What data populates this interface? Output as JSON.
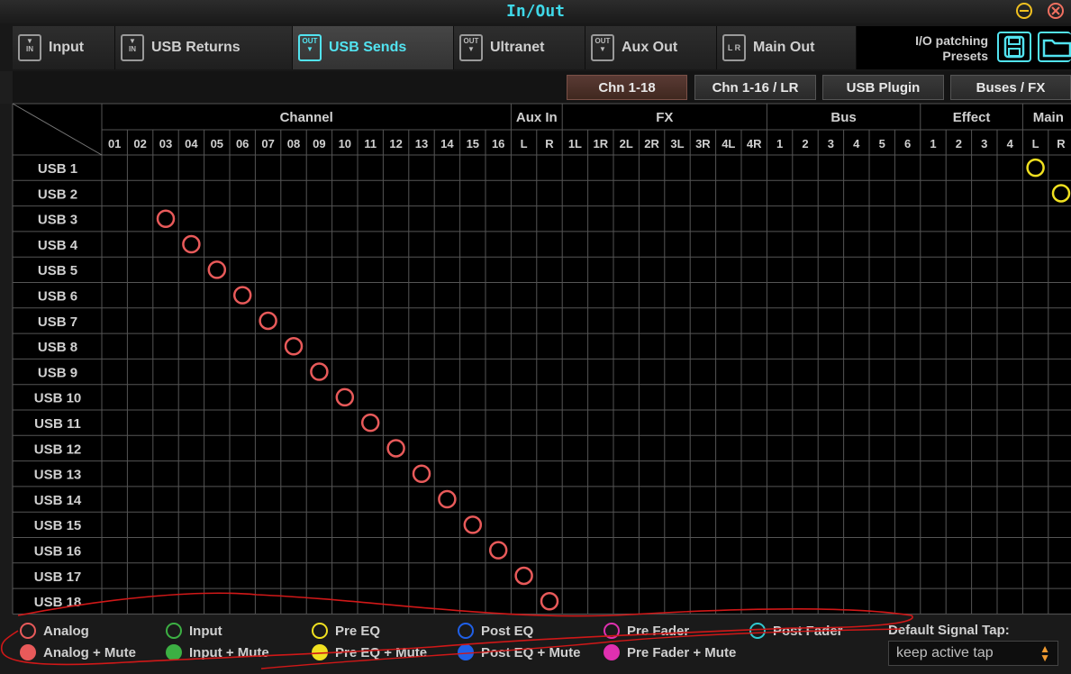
{
  "window": {
    "title": "In/Out"
  },
  "tabs": [
    {
      "label": "Input",
      "icon": "in-port-icon",
      "icon_text": "IN"
    },
    {
      "label": "USB Returns",
      "icon": "in-port-icon",
      "icon_text": "IN"
    },
    {
      "label": "USB Sends",
      "icon": "out-port-icon",
      "icon_text": "OUT",
      "active": true
    },
    {
      "label": "Ultranet",
      "icon": "out-port-icon",
      "icon_text": "OUT"
    },
    {
      "label": "Aux Out",
      "icon": "out-port-icon",
      "icon_text": "OUT"
    },
    {
      "label": "Main Out",
      "icon": "lr-fader-icon",
      "icon_text": "L R"
    }
  ],
  "presets": {
    "line1": "I/O patching",
    "line2": "Presets"
  },
  "subtabs": [
    "Chn 1-18",
    "Chn 1-16 / LR",
    "USB Plugin",
    "Buses / FX"
  ],
  "active_subtab": 0,
  "groups": [
    {
      "label": "Channel",
      "span": 16
    },
    {
      "label": "Aux In",
      "span": 2
    },
    {
      "label": "FX",
      "span": 8
    },
    {
      "label": "Bus",
      "span": 6
    },
    {
      "label": "Effect",
      "span": 4
    },
    {
      "label": "Main",
      "span": 2
    }
  ],
  "columns": [
    "01",
    "02",
    "03",
    "04",
    "05",
    "06",
    "07",
    "08",
    "09",
    "10",
    "11",
    "12",
    "13",
    "14",
    "15",
    "16",
    "L",
    "R",
    "1L",
    "1R",
    "2L",
    "2R",
    "3L",
    "3R",
    "4L",
    "4R",
    "1",
    "2",
    "3",
    "4",
    "5",
    "6",
    "1",
    "2",
    "3",
    "4",
    "L",
    "R"
  ],
  "rows": [
    "USB 1",
    "USB 2",
    "USB 3",
    "USB 4",
    "USB 5",
    "USB 6",
    "USB 7",
    "USB 8",
    "USB 9",
    "USB 10",
    "USB 11",
    "USB 12",
    "USB 13",
    "USB 14",
    "USB 15",
    "USB 16",
    "USB 17",
    "USB 18"
  ],
  "patches": [
    {
      "row": 0,
      "col": 36,
      "type": "pre-eq"
    },
    {
      "row": 1,
      "col": 37,
      "type": "pre-eq"
    },
    {
      "row": 2,
      "col": 2,
      "type": "analog"
    },
    {
      "row": 3,
      "col": 3,
      "type": "analog"
    },
    {
      "row": 4,
      "col": 4,
      "type": "analog"
    },
    {
      "row": 5,
      "col": 5,
      "type": "analog"
    },
    {
      "row": 6,
      "col": 6,
      "type": "analog"
    },
    {
      "row": 7,
      "col": 7,
      "type": "analog"
    },
    {
      "row": 8,
      "col": 8,
      "type": "analog"
    },
    {
      "row": 9,
      "col": 9,
      "type": "analog"
    },
    {
      "row": 10,
      "col": 10,
      "type": "analog"
    },
    {
      "row": 11,
      "col": 11,
      "type": "analog"
    },
    {
      "row": 12,
      "col": 12,
      "type": "analog"
    },
    {
      "row": 13,
      "col": 13,
      "type": "analog"
    },
    {
      "row": 14,
      "col": 14,
      "type": "analog"
    },
    {
      "row": 15,
      "col": 15,
      "type": "analog"
    },
    {
      "row": 16,
      "col": 16,
      "type": "analog"
    },
    {
      "row": 17,
      "col": 17,
      "type": "analog"
    }
  ],
  "legend": [
    {
      "label": "Analog",
      "color": "#e85a5a",
      "filled": false
    },
    {
      "label": "Input",
      "color": "#3cb043",
      "filled": false
    },
    {
      "label": "Pre EQ",
      "color": "#f0e020",
      "filled": false
    },
    {
      "label": "Post EQ",
      "color": "#2060e8",
      "filled": false
    },
    {
      "label": "Pre Fader",
      "color": "#e030b0",
      "filled": false
    },
    {
      "label": "Post Fader",
      "color": "#30c8d0",
      "filled": false
    },
    {
      "label": "Analog + Mute",
      "color": "#e85a5a",
      "filled": true
    },
    {
      "label": "Input + Mute",
      "color": "#3cb043",
      "filled": true
    },
    {
      "label": "Pre EQ + Mute",
      "color": "#f0e020",
      "filled": true
    },
    {
      "label": "Post EQ + Mute",
      "color": "#2060e8",
      "filled": true
    },
    {
      "label": "Pre Fader + Mute",
      "color": "#e030b0",
      "filled": true
    }
  ],
  "signal_tap": {
    "label": "Default Signal Tap:",
    "value": "keep active tap"
  },
  "colors": {
    "accent": "#52e3f0",
    "analog": "#e85a5a",
    "pre_eq": "#f0e020",
    "annotation": "#d01818"
  }
}
